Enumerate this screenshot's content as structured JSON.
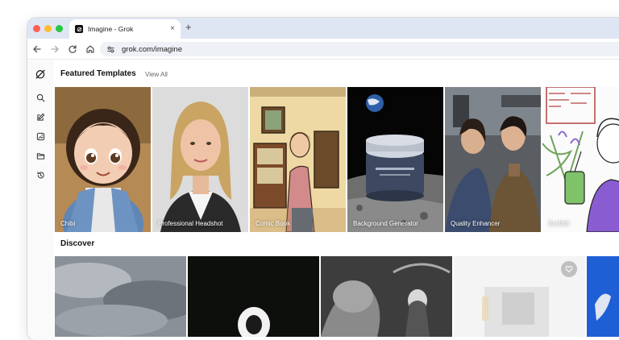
{
  "browser": {
    "tab_title": "Imagine - Grok",
    "tab_close": "×",
    "new_tab": "+",
    "url": "grok.com/imagine"
  },
  "sidebar": {
    "items": [
      {
        "icon": "grok-logo-icon"
      },
      {
        "icon": "search-icon"
      },
      {
        "icon": "edit-icon"
      },
      {
        "icon": "imagine-icon"
      },
      {
        "icon": "folder-icon"
      },
      {
        "icon": "history-icon"
      }
    ]
  },
  "featured": {
    "title": "Featured Templates",
    "view_all": "View All",
    "templates": [
      {
        "label": "Chibi"
      },
      {
        "label": "Professional Headshot"
      },
      {
        "label": "Comic Book"
      },
      {
        "label": "Background Generator"
      },
      {
        "label": "Quality Enhancer"
      },
      {
        "label": "Scribbli"
      }
    ]
  },
  "discover": {
    "title": "Discover"
  },
  "colors": {
    "tabbar": "#dfe6f3",
    "accent_blue": "#1f5fd6"
  }
}
